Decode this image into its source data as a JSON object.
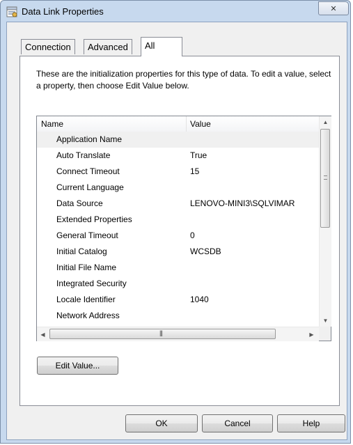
{
  "window": {
    "title": "Data Link Properties",
    "close_glyph": "✕"
  },
  "tabs": [
    {
      "label": "Connection",
      "active": false
    },
    {
      "label": "Advanced",
      "active": false
    },
    {
      "label": "All",
      "active": true
    }
  ],
  "description": "These are the initialization properties for this type of data. To edit a value, select a property, then choose Edit Value below.",
  "grid": {
    "columns": [
      "Name",
      "Value"
    ],
    "rows": [
      {
        "name": "Application Name",
        "value": ""
      },
      {
        "name": "Auto Translate",
        "value": "True"
      },
      {
        "name": "Connect Timeout",
        "value": "15"
      },
      {
        "name": "Current Language",
        "value": ""
      },
      {
        "name": "Data Source",
        "value": "LENOVO-MINI3\\SQLVIMAR"
      },
      {
        "name": "Extended Properties",
        "value": ""
      },
      {
        "name": "General Timeout",
        "value": "0"
      },
      {
        "name": "Initial Catalog",
        "value": "WCSDB"
      },
      {
        "name": "Initial File Name",
        "value": ""
      },
      {
        "name": "Integrated Security",
        "value": ""
      },
      {
        "name": "Locale Identifier",
        "value": "1040"
      },
      {
        "name": "Network Address",
        "value": ""
      }
    ],
    "selected_row": 0
  },
  "buttons": {
    "edit_value": "Edit Value...",
    "ok": "OK",
    "cancel": "Cancel",
    "help": "Help"
  },
  "icons": {
    "app": "data-link-icon",
    "close": "close-icon",
    "scroll_up": "scroll-up-icon",
    "scroll_down": "scroll-down-icon",
    "scroll_left": "scroll-left-icon",
    "scroll_right": "scroll-right-icon"
  },
  "colors": {
    "frame": "#c7d9ee",
    "client": "#f0f0f0",
    "panel": "#ffffff",
    "selected_row": "#f0f0f0"
  }
}
